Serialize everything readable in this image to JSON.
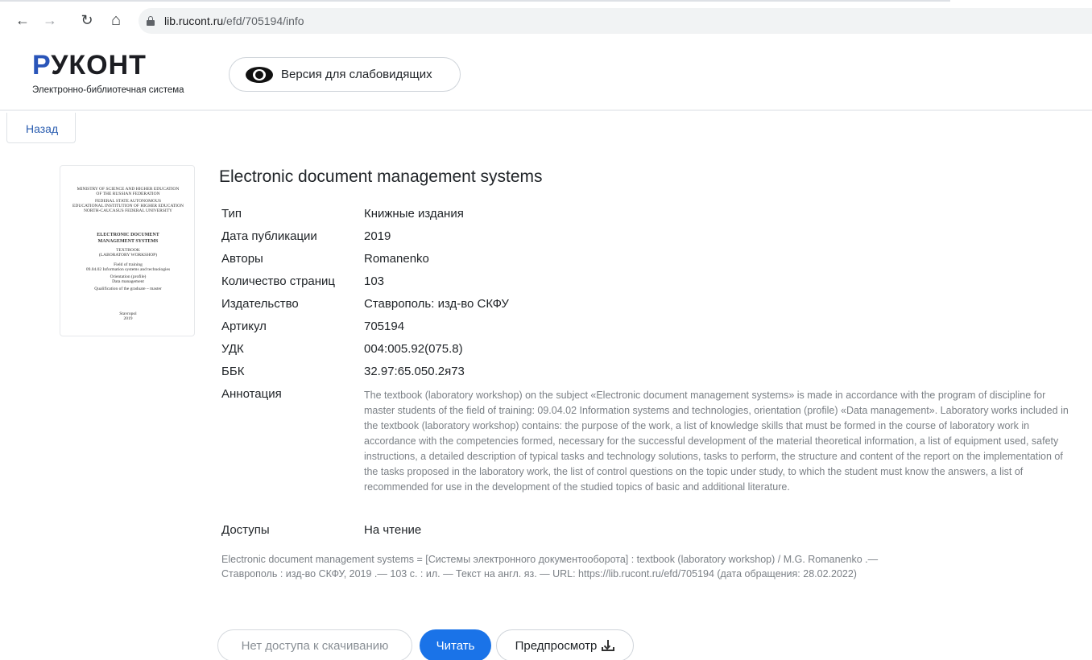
{
  "browser": {
    "url_host": "lib.rucont.ru",
    "url_path": "/efd/705194/info",
    "back_glyph": "←",
    "forward_glyph": "→",
    "reload_glyph": "↻",
    "home_glyph": "⌂"
  },
  "site": {
    "logo_first": "Р",
    "logo_rest": "УКОНТ",
    "logo_subtitle": "Электронно-библиотечная система",
    "vision_button": "Версия для слабовидящих",
    "back_tab": "Назад"
  },
  "cover": {
    "header_lines": [
      "MINISTRY OF SCIENCE AND HIGHER EDUCATION",
      "OF THE RUSSIAN FEDERATION",
      "FEDERAL STATE AUTONOMOUS",
      "EDUCATIONAL INSTITUTION OF HIGHER EDUCATION",
      "NORTH-CAUCASUS FEDERAL UNIVERSITY"
    ],
    "title_lines": [
      "ELECTRONIC DOCUMENT",
      "MANAGEMENT SYSTEMS"
    ],
    "subtitle_lines": [
      "TEXTBOOK",
      "(LABORATORY WORKSHOP)"
    ],
    "info_lines": [
      "Field of training",
      "09.04.02 Information systems and technologies",
      "Orientation (profile)",
      "Data management",
      "Qualification of the graduate – master"
    ],
    "footer_lines": [
      "Stavropol",
      "2019"
    ]
  },
  "book": {
    "title": "Electronic document management systems",
    "rows": [
      {
        "label": "Тип",
        "value": "Книжные издания"
      },
      {
        "label": "Дата публикации",
        "value": "2019"
      },
      {
        "label": "Авторы",
        "value": "Romanenko"
      },
      {
        "label": "Количество страниц",
        "value": "103"
      },
      {
        "label": "Издательство",
        "value": "Ставрополь: изд-во СКФУ"
      },
      {
        "label": "Артикул",
        "value": "705194"
      },
      {
        "label": "УДК",
        "value": "004:005.92(075.8)"
      },
      {
        "label": "ББК",
        "value": "32.97:65.050.2я73"
      }
    ],
    "annotation_label": "Аннотация",
    "annotation": "The textbook (laboratory workshop) on the subject «Electronic document management systems» is made in accordance with the program of discipline for master students of the field of training: 09.04.02 Information systems and technologies, orientation (profile) «Data management». Laboratory works included in the textbook (laboratory workshop) contains: the purpose of the work, a list of knowledge skills that must be formed in the course of laboratory work in accordance with the competencies formed, necessary for the successful development of the material theoretical information, a list of equipment used, safety instructions, a detailed description of typical tasks and technology solutions, tasks to perform, the structure and content of the report on the implementation of the tasks proposed in the laboratory work, the list of control questions on the topic under study, to which the student must know the answers, a list of recommended for use in the development of the studied topics of basic and additional literature.",
    "access_label": "Доступы",
    "access_value": "На чтение",
    "citation": "Electronic document management systems = [Системы электронного документооборота] : textbook (laboratory workshop) / M.G. Romanenko .— Ставрополь : изд-во СКФУ, 2019 .— 103 с. : ил. — Текст на англ. яз. — URL: https://lib.rucont.ru/efd/705194 (дата обращения: 28.02.2022)"
  },
  "actions": {
    "no_download": "Нет доступа к скачиванию",
    "read": "Читать",
    "preview": "Предпросмотр"
  }
}
